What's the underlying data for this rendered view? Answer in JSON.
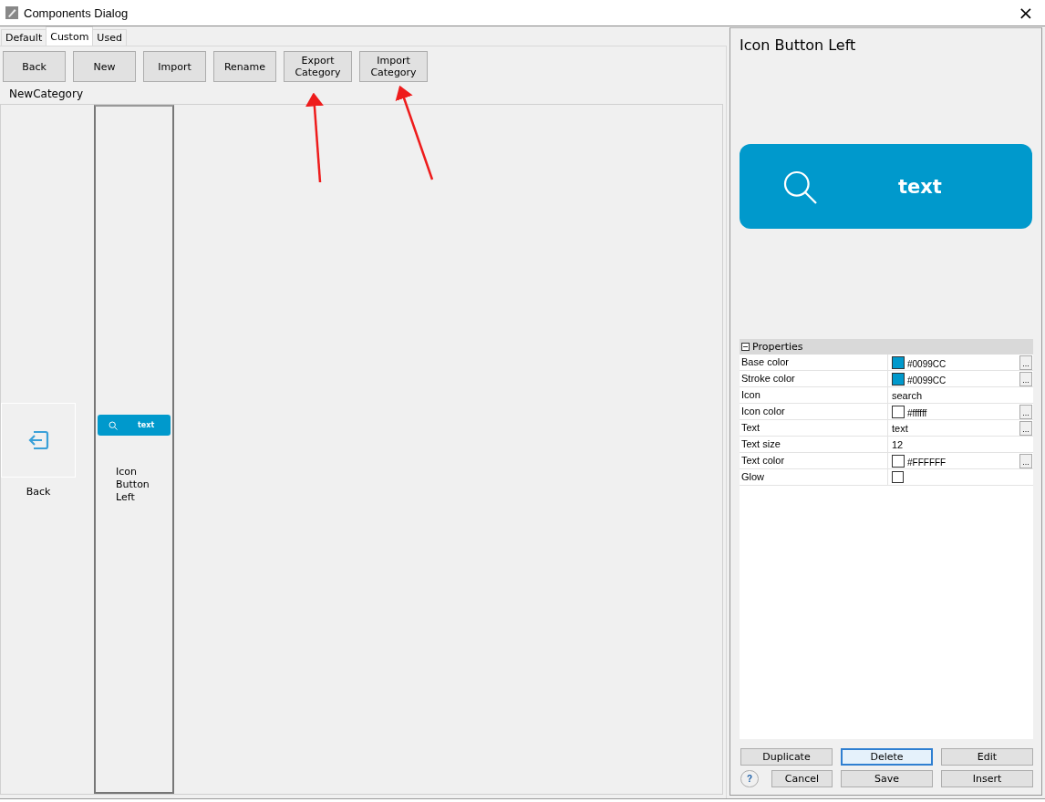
{
  "window": {
    "title": "Components Dialog",
    "close": "×"
  },
  "tabs": [
    {
      "label": "Default",
      "selected": false
    },
    {
      "label": "Custom",
      "selected": true
    },
    {
      "label": "Used",
      "selected": false
    }
  ],
  "toolbar": [
    {
      "label": "Back"
    },
    {
      "label": "New"
    },
    {
      "label": "Import"
    },
    {
      "label": "Rename"
    },
    {
      "label": "Export Category"
    },
    {
      "label": "Import Category"
    }
  ],
  "category": "NewCategory",
  "components": [
    {
      "kind": "back",
      "label": "Back",
      "selected": false
    },
    {
      "kind": "icon_button",
      "label": "Icon Button Left",
      "thumb_text": "text",
      "color": "#0099cc",
      "selected": true
    }
  ],
  "detail": {
    "title": "Icon Button Left",
    "preview": {
      "text": "text",
      "color": "#0099cc"
    }
  },
  "properties": {
    "header": "Properties",
    "expanded": true,
    "rows": [
      {
        "kind": "color",
        "name": "Base color",
        "value": "#0099CC",
        "color": "#0099cc",
        "more": "..."
      },
      {
        "kind": "color",
        "name": "Stroke color",
        "value": "#0099CC",
        "color": "#0099cc",
        "more": "..."
      },
      {
        "kind": "text",
        "name": "Icon",
        "value": "search"
      },
      {
        "kind": "color",
        "name": "Icon color",
        "value": "#ffffff",
        "color": "#ffffff",
        "more": "..."
      },
      {
        "kind": "text",
        "name": "Text",
        "value": "text",
        "more": "..."
      },
      {
        "kind": "text",
        "name": "Text size",
        "value": "12"
      },
      {
        "kind": "color",
        "name": "Text color",
        "value": "#FFFFFF",
        "color": "#ffffff",
        "more": "..."
      },
      {
        "kind": "checkbox",
        "name": "Glow",
        "checked": false
      }
    ]
  },
  "buttons": [
    {
      "label": "Duplicate",
      "selected": false
    },
    {
      "label": "Delete",
      "selected": true
    },
    {
      "label": "Edit",
      "selected": false
    },
    {
      "label": "Cancel",
      "selected": false
    },
    {
      "label": "Save",
      "selected": false
    },
    {
      "label": "Insert",
      "selected": false
    }
  ],
  "help": "?"
}
